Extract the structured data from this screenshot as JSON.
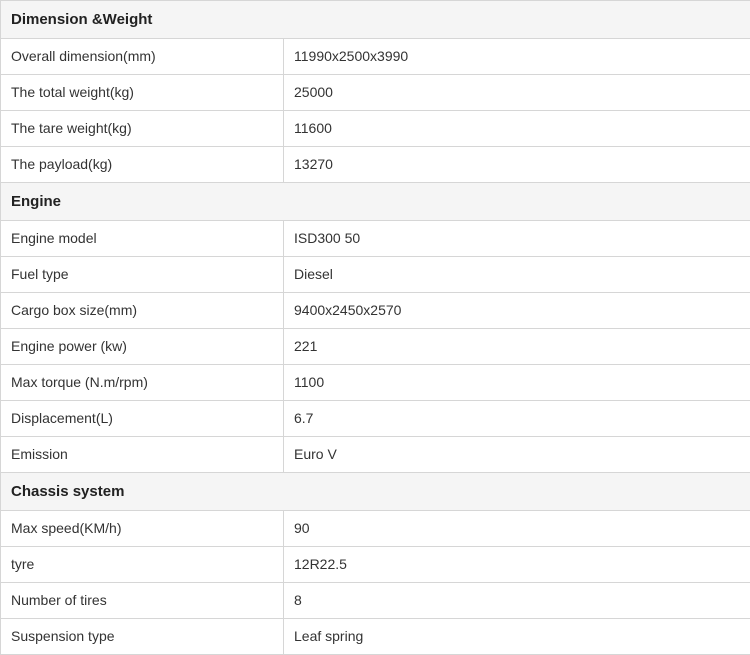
{
  "sections": [
    {
      "title": "Dimension &Weight",
      "rows": [
        {
          "label": "Overall dimension(mm)",
          "value": "11990x2500x3990"
        },
        {
          "label": "The total weight(kg)",
          "value": "25000"
        },
        {
          "label": "The tare weight(kg)",
          "value": "11600"
        },
        {
          "label": "The payload(kg)",
          "value": "13270"
        }
      ]
    },
    {
      "title": "Engine",
      "rows": [
        {
          "label": "Engine model",
          "value": "ISD300 50"
        },
        {
          "label": "Fuel type",
          "value": "Diesel"
        },
        {
          "label": "Cargo box size(mm)",
          "value": "9400x2450x2570"
        },
        {
          "label": "Engine power (kw)",
          "value": "221"
        },
        {
          "label": "Max torque (N.m/rpm)",
          "value": "1100"
        },
        {
          "label": "Displacement(L)",
          "value": "6.7"
        },
        {
          "label": "Emission",
          "value": "Euro V"
        }
      ]
    },
    {
      "title": "Chassis system",
      "rows": [
        {
          "label": "Max speed(KM/h)",
          "value": "90"
        },
        {
          "label": "tyre",
          "value": "12R22.5"
        },
        {
          "label": "Number of tires",
          "value": "8"
        },
        {
          "label": "Suspension type",
          "value": "Leaf spring"
        }
      ]
    }
  ]
}
